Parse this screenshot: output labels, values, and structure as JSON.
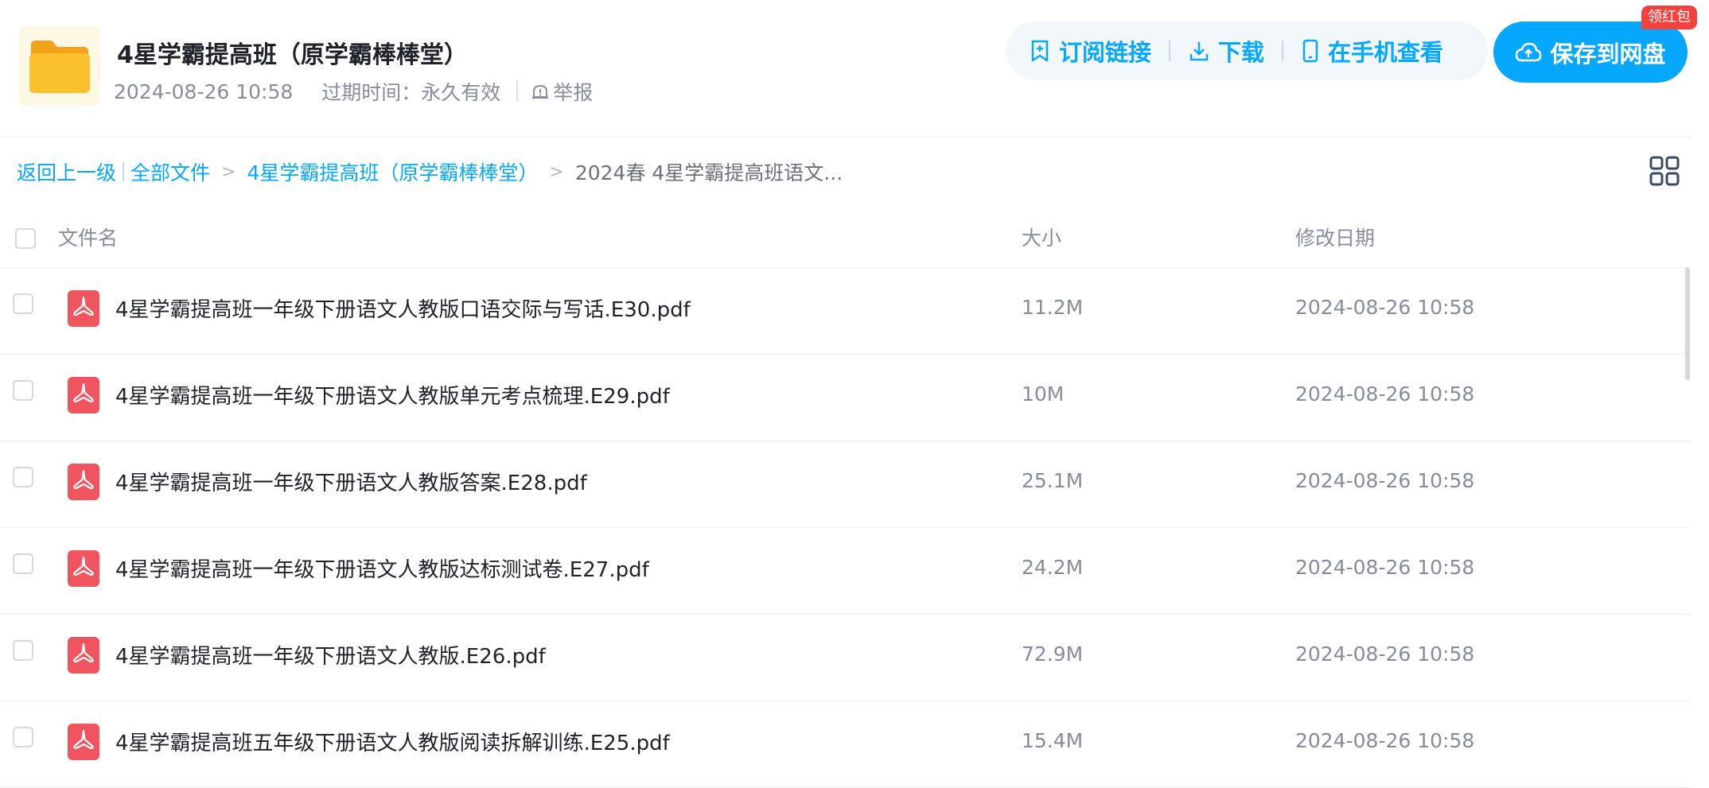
{
  "header": {
    "title": "4星学霸提高班（原学霸棒棒堂）",
    "share_time": "2024-08-26 10:58",
    "expire_text": "过期时间：永久有效",
    "report_label": "举报",
    "actions": {
      "subscribe": "订阅链接",
      "download": "下载",
      "mobile": "在手机查看"
    },
    "save_label": "保存到网盘",
    "badge": "领红包"
  },
  "breadcrumb": {
    "back": "返回上一级",
    "all_files": "全部文件",
    "parent": "4星学霸提高班（原学霸棒棒堂）",
    "current": "2024春 4星学霸提高班语文..."
  },
  "table": {
    "columns": {
      "name": "文件名",
      "size": "大小",
      "date": "修改日期"
    },
    "rows": [
      {
        "name": "4星学霸提高班一年级下册语文人教版口语交际与写话.E30.pdf",
        "size": "11.2M",
        "date": "2024-08-26 10:58"
      },
      {
        "name": "4星学霸提高班一年级下册语文人教版单元考点梳理.E29.pdf",
        "size": "10M",
        "date": "2024-08-26 10:58"
      },
      {
        "name": "4星学霸提高班一年级下册语文人教版答案.E28.pdf",
        "size": "25.1M",
        "date": "2024-08-26 10:58"
      },
      {
        "name": "4星学霸提高班一年级下册语文人教版达标测试卷.E27.pdf",
        "size": "24.2M",
        "date": "2024-08-26 10:58"
      },
      {
        "name": "4星学霸提高班一年级下册语文人教版.E26.pdf",
        "size": "72.9M",
        "date": "2024-08-26 10:58"
      },
      {
        "name": "4星学霸提高班五年级下册语文人教版阅读拆解训练.E25.pdf",
        "size": "15.4M",
        "date": "2024-08-26 10:58"
      }
    ]
  },
  "icons": {
    "folder": "folder-icon",
    "pdf": "pdf-file-icon",
    "subscribe": "bookmark-plus-icon",
    "download": "download-icon",
    "mobile": "phone-icon",
    "save": "cloud-upload-icon",
    "report": "alert-icon",
    "view_toggle": "grid-view-icon"
  },
  "colors": {
    "accent": "#06a7ff",
    "badge": "#f3423e",
    "pdf": "#f0555f",
    "folder": "#fbc02d"
  }
}
